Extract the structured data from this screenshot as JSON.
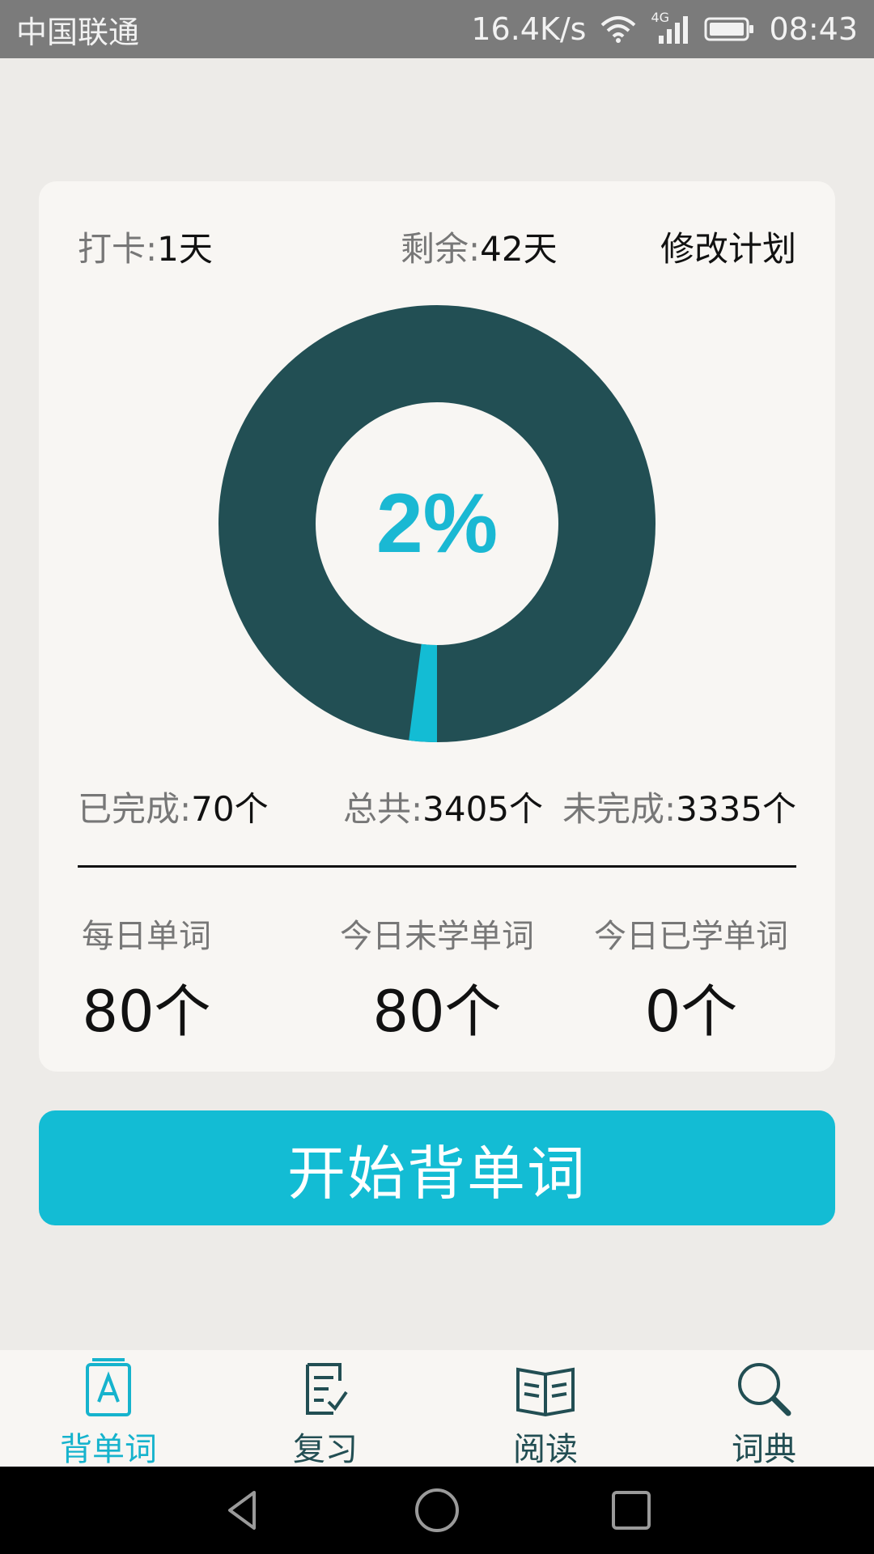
{
  "status_bar": {
    "carrier": "中国联通",
    "speed": "16.4K/s",
    "network": "4G",
    "time": "08:43"
  },
  "plan": {
    "checkin_label": "打卡:",
    "checkin_value": "1天",
    "remaining_label": "剩余:",
    "remaining_value": "42天",
    "edit_label": "修改计划"
  },
  "progress": {
    "percent_text": "2%",
    "fraction": 0.0206,
    "ring_color": "#224f54",
    "progress_color": "#13bcd4"
  },
  "counts": {
    "completed_label": "已完成:",
    "completed_value": "70个",
    "total_label": "总共:",
    "total_value": "3405个",
    "incomplete_label": "未完成:",
    "incomplete_value": "3335个"
  },
  "daily": {
    "per_day_label": "每日单词",
    "per_day_value": "80个",
    "today_unlearned_label": "今日未学单词",
    "today_unlearned_value": "80个",
    "today_learned_label": "今日已学单词",
    "today_learned_value": "0个"
  },
  "start_button": "开始背单词",
  "tabs": [
    {
      "label": "背单词",
      "icon": "word-card-icon",
      "active": true
    },
    {
      "label": "复习",
      "icon": "review-icon",
      "active": false
    },
    {
      "label": "阅读",
      "icon": "book-icon",
      "active": false
    },
    {
      "label": "词典",
      "icon": "search-icon",
      "active": false
    }
  ],
  "colors": {
    "accent": "#13bcd4",
    "dark_teal": "#224f54"
  }
}
